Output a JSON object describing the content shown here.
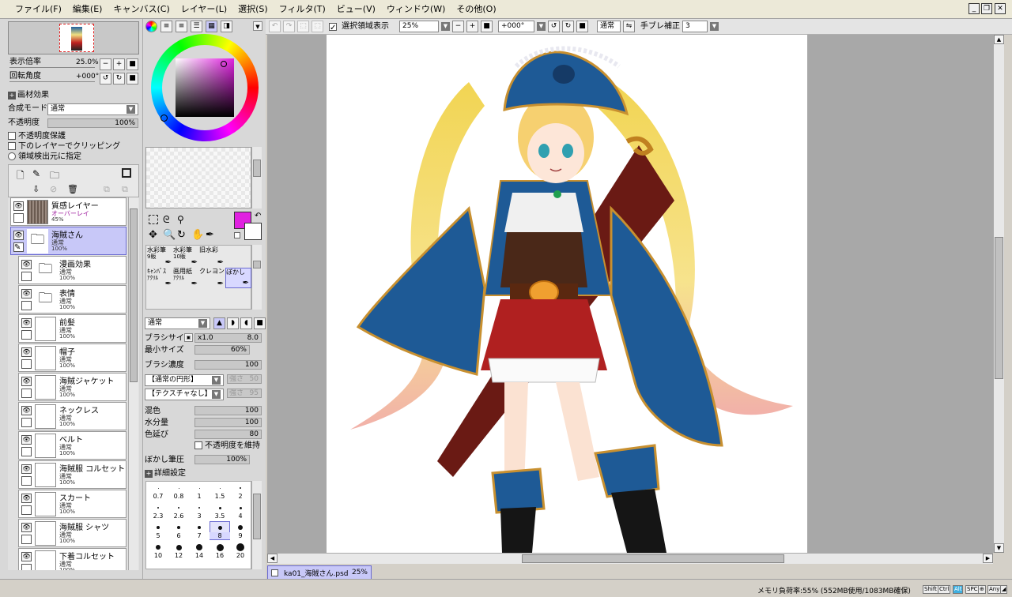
{
  "menu": [
    "ファイル(F)",
    "編集(E)",
    "キャンバス(C)",
    "レイヤー(L)",
    "選択(S)",
    "フィルタ(T)",
    "ビュー(V)",
    "ウィンドウ(W)",
    "その他(O)"
  ],
  "window_controls": {
    "minimize": "_",
    "restore": "❐",
    "close": "✕"
  },
  "toolbar": {
    "selection_label": "選択領域表示",
    "zoom": "25%",
    "rotation": "+000°",
    "mode": "通常",
    "stabilizer_label": "手ブレ補正",
    "stabilizer": "3"
  },
  "navigator": {
    "zoom_label": "表示倍率",
    "zoom_value": "25.0%",
    "rotation_label": "回転角度",
    "rotation_value": "+000°"
  },
  "layer_props": {
    "section": "画材効果",
    "blend_label": "合成モード",
    "blend_value": "通常",
    "opacity_label": "不透明度",
    "opacity_value": "100%",
    "protect_opacity": "不透明度保護",
    "clip_lower": "下のレイヤーでクリッピング",
    "selection_source": "領域検出元に指定"
  },
  "layers": [
    {
      "name": "質感レイヤー",
      "mode": "オーバーレイ",
      "opacity": "45%",
      "type": "texture"
    },
    {
      "name": "海賊さん",
      "mode": "通常",
      "opacity": "100%",
      "type": "folder",
      "selected": true
    },
    {
      "name": "漫画効果",
      "mode": "通常",
      "opacity": "100%",
      "type": "folder"
    },
    {
      "name": "表情",
      "mode": "通常",
      "opacity": "100%",
      "type": "folder"
    },
    {
      "name": "前髪",
      "mode": "通常",
      "opacity": "100%",
      "type": "layer"
    },
    {
      "name": "帽子",
      "mode": "通常",
      "opacity": "100%",
      "type": "layer"
    },
    {
      "name": "海賊ジャケット",
      "mode": "通常",
      "opacity": "100%",
      "type": "layer"
    },
    {
      "name": "ネックレス",
      "mode": "通常",
      "opacity": "100%",
      "type": "layer"
    },
    {
      "name": "ベルト",
      "mode": "通常",
      "opacity": "100%",
      "type": "layer"
    },
    {
      "name": "海賊服 コルセット",
      "mode": "通常",
      "opacity": "100%",
      "type": "layer"
    },
    {
      "name": "スカート",
      "mode": "通常",
      "opacity": "100%",
      "type": "layer"
    },
    {
      "name": "海賊服 シャツ",
      "mode": "通常",
      "opacity": "100%",
      "type": "layer"
    },
    {
      "name": "下着コルセット",
      "mode": "通常",
      "opacity": "100%",
      "type": "layer"
    }
  ],
  "brushes": [
    {
      "line1": "水彩筆",
      "line2": "9販"
    },
    {
      "line1": "水彩筆",
      "line2": "10販"
    },
    {
      "line1": "旧水彩",
      "line2": ""
    },
    {
      "line1": "",
      "line2": ""
    },
    {
      "line1": "ｷｬﾝﾊﾞｽ",
      "line2": "ｱｸﾘﾙ"
    },
    {
      "line1": "画用紙",
      "line2": "ｱｸﾘﾙ"
    },
    {
      "line1": "クレヨン",
      "line2": ""
    },
    {
      "line1": "ぼかし",
      "line2": "",
      "selected": true
    }
  ],
  "brush_settings": {
    "blend": "通常",
    "size_label": "ブラシサイズ",
    "size_mult": "x1.0",
    "size_value": "8.0",
    "min_size_label": "最小サイズ",
    "min_size_value": "60%",
    "density_label": "ブラシ濃度",
    "density_value": "100",
    "shape": "【通常の円形】",
    "shape_strength_label": "強さ",
    "shape_strength": "50",
    "texture": "【テクスチャなし】",
    "texture_strength_label": "強さ",
    "texture_strength": "95",
    "mix_label": "混色",
    "mix_value": "100",
    "water_label": "水分量",
    "water_value": "100",
    "extend_label": "色延び",
    "extend_value": "80",
    "keep_opacity": "不透明度を維持",
    "blur_label": "ぼかし筆圧",
    "blur_value": "100%",
    "detail_label": "詳細設定"
  },
  "brush_sizes": [
    "0.7",
    "0.8",
    "1",
    "1.5",
    "2",
    "2.3",
    "2.6",
    "3",
    "3.5",
    "4",
    "5",
    "6",
    "7",
    "8",
    "9",
    "10",
    "12",
    "14",
    "16",
    "20"
  ],
  "colors": {
    "primary": "#e020e0",
    "secondary": "#ffffff",
    "accent_select": "#c8c8f8"
  },
  "tab": {
    "file": "ka01_海賊さん.psd",
    "zoom": "25%"
  },
  "status": {
    "memory": "メモリ負荷率:55% (552MB使用/1083MB確保)",
    "keys": [
      "Shift",
      "Ctrl",
      "Alt",
      "SPC",
      "⊕",
      "Any",
      "◢"
    ]
  }
}
